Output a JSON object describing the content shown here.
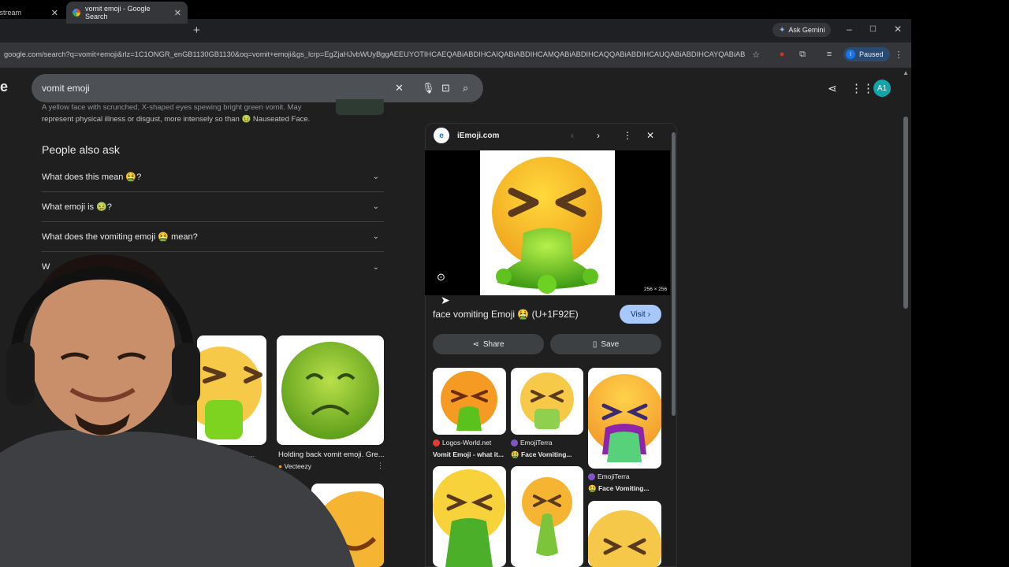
{
  "browser": {
    "tabs": [
      {
        "title": "Restream"
      },
      {
        "title": "vomit emoji - Google Search"
      }
    ],
    "new_tab": "+",
    "gemini_label": "Ask Gemini",
    "url": "google.com/search?q=vomit+emoji&rlz=1C1ONGR_enGB1130GB1130&oq=vomit+emoji&gs_lcrp=EgZjaHJvbWUyBggAEEUYOTIHCAEQABiABDIHCAIQABiABDIHCAMQABiABDIHCAQQABiABDIHCAUQABiABDIHCAYQABiABDIHC...",
    "profile_initial": "I",
    "profile_status": "Paused",
    "window": {
      "min": "–",
      "max": "☐",
      "close": "✕"
    }
  },
  "search": {
    "logo_fragment": "e",
    "query": "vomit emoji",
    "avatar_initials": "A1"
  },
  "results": {
    "snippet_line1": "A yellow face with scrunched, X-shaped eyes spewing bright green vomit. May",
    "snippet_line2": "represent physical illness or disgust, more intensely so than 🤢 Nauseated Face.",
    "people_also_ask": {
      "title": "People also ask",
      "questions": [
        "What does this mean 🤮?",
        "What emoji is 🤢?",
        "What does the vomiting emoji 🤮 mean?",
        "W"
      ]
    },
    "image_results": [
      {
        "source": "...",
        "title": ""
      },
      {
        "title": "Holding back vomit emoji. Gre...",
        "source": "Vecteezy"
      }
    ]
  },
  "preview": {
    "site": "iEmoji.com",
    "dimensions": "256 × 256",
    "title": "face vomiting Emoji 🤮 (U+1F92E)",
    "visit_label": "Visit",
    "share_label": "Share",
    "save_label": "Save",
    "related": [
      {
        "source": "Logos-World.net",
        "title": "Vomit Emoji - what it..."
      },
      {
        "source": "EmojiTerra",
        "title": "🤮 Face Vomiting..."
      },
      {
        "source": "EmojiTerra",
        "title": "🤮 Face Vomiting..."
      }
    ]
  },
  "colors": {
    "page_bg": "#1f1f1f",
    "chrome_bg": "#35363a",
    "accent": "#a8c7fa",
    "emoji_yellow": "#f7c948",
    "vomit_green": "#7ed321"
  }
}
